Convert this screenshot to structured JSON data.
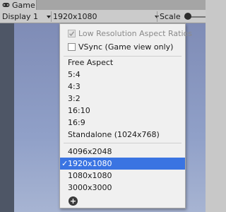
{
  "tab": {
    "title": "Game",
    "icon": "gamepad-icon"
  },
  "toolbar": {
    "display": "Display 1",
    "resolution": "1920x1080",
    "scale_label": "Scale"
  },
  "dropdown": {
    "low_res_label": "Low Resolution Aspect Ratios",
    "low_res_checked": true,
    "low_res_enabled": false,
    "vsync_label": "VSync (Game view only)",
    "vsync_checked": false,
    "aspects": [
      "Free Aspect",
      "5:4",
      "4:3",
      "3:2",
      "16:10",
      "16:9",
      "Standalone (1024x768)"
    ],
    "resolutions": [
      "4096x2048",
      "1920x1080",
      "1080x1080",
      "3000x3000"
    ],
    "selected_resolution": "1920x1080",
    "check_glyph": "✓",
    "add_glyph": "+"
  },
  "colors": {
    "selection": "#3a74e2"
  }
}
